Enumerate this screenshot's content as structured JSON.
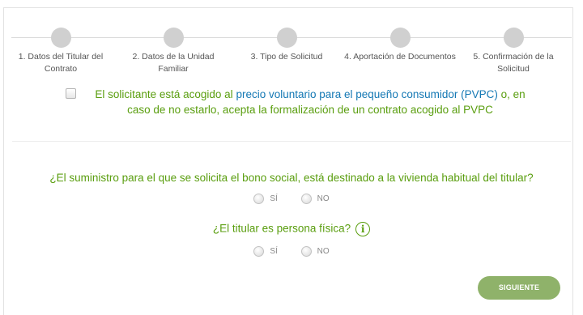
{
  "stepper": {
    "steps": [
      {
        "label": "1. Datos del Titular del Contrato"
      },
      {
        "label": "2. Datos de la Unidad Familiar"
      },
      {
        "label": "3. Tipo de Solicitud"
      },
      {
        "label": "4. Aportación de Documentos"
      },
      {
        "label": "5. Confirmación de la Solicitud"
      }
    ]
  },
  "pvpc": {
    "text_before": "El solicitante está acogido al ",
    "link_text": "precio voluntario para el pequeño consumidor (PVPC)",
    "text_after": " o, en caso de no estarlo, acepta la formalización de un contrato acogido al PVPC"
  },
  "questions": [
    {
      "text": "¿El suministro para el que se solicita el bono social, está destinado a la vivienda habitual del titular?",
      "options": [
        "SÍ",
        "NO"
      ]
    },
    {
      "text": "¿El titular es persona física?",
      "info_icon": "info-icon",
      "info_glyph": "i",
      "options": [
        "SÍ",
        "NO"
      ]
    }
  ],
  "actions": {
    "next_label": "SIGUIENTE"
  },
  "colors": {
    "accent": "#5a9e0f",
    "link": "#1478b4",
    "button": "#8fb26a",
    "step_dot": "#d0d0d0"
  }
}
